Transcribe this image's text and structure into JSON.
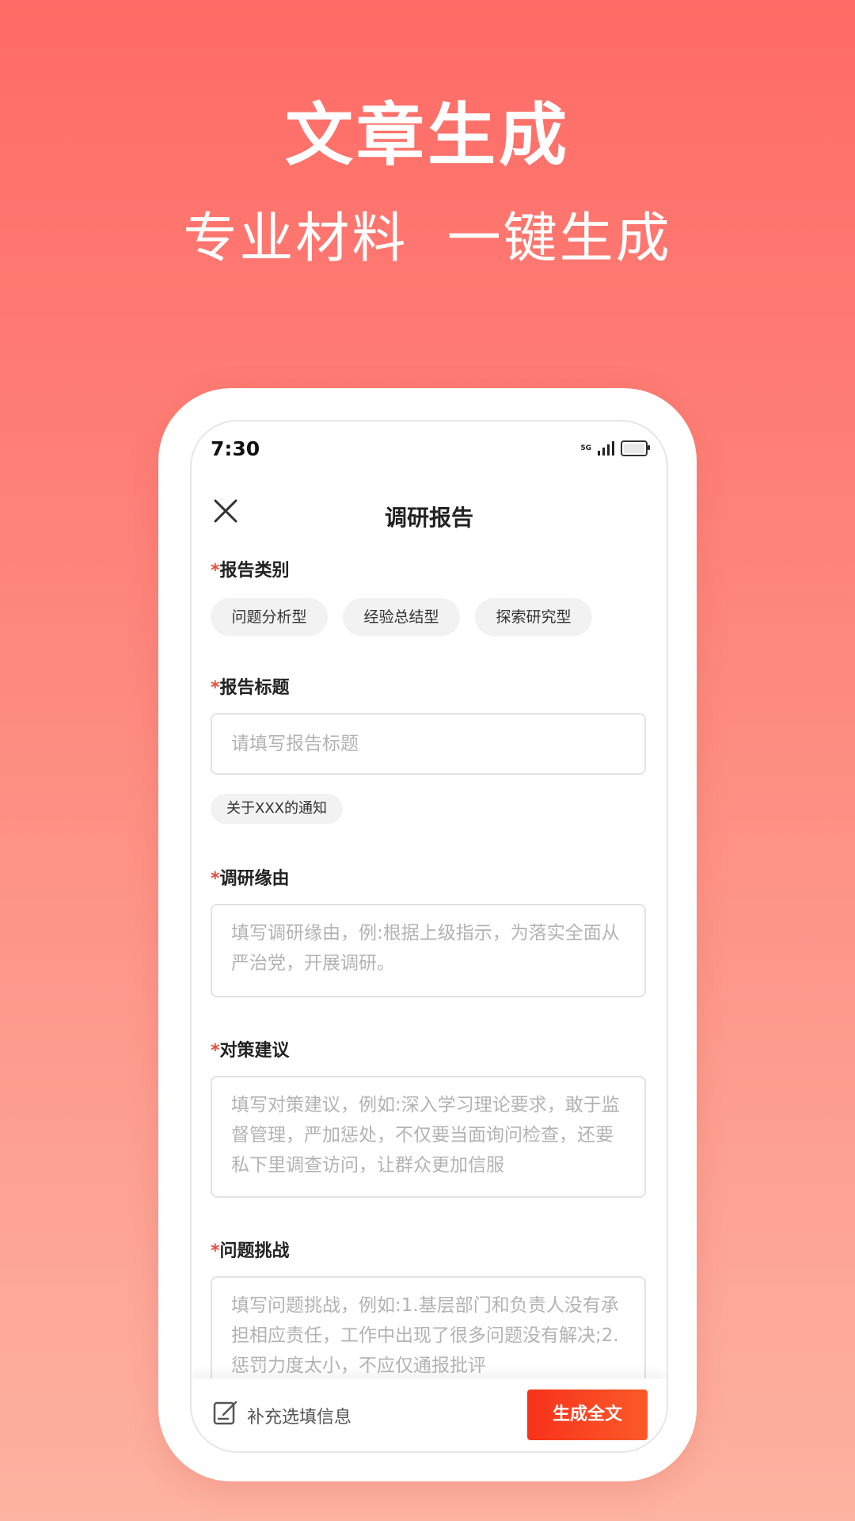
{
  "hero": {
    "title": "文章生成",
    "subtitle": "专业材料  一键生成"
  },
  "status_bar": {
    "time": "7:30",
    "network": "5G"
  },
  "nav": {
    "title": "调研报告"
  },
  "form": {
    "required_mark": "*",
    "report_category": {
      "label": "报告类别",
      "options": [
        "问题分析型",
        "经验总结型",
        "探索研究型"
      ]
    },
    "report_title": {
      "label": "报告标题",
      "placeholder": "请填写报告标题",
      "suggestion": "关于XXX的通知"
    },
    "research_reason": {
      "label": "调研缘由",
      "placeholder": "填写调研缘由，例:根据上级指示，为落实全面从严治党，开展调研。"
    },
    "countermeasures": {
      "label": "对策建议",
      "placeholder": "填写对策建议，例如:深入学习理论要求，敢于监督管理，严加惩处，不仅要当面询问检查，还要私下里调查访问，让群众更加信服"
    },
    "challenges": {
      "label": "问题挑战",
      "placeholder": "填写问题挑战，例如:1.基层部门和负责人没有承担相应责任，工作中出现了很多问题没有解决;2.惩罚力度太小，不应仅通报批评"
    }
  },
  "footer": {
    "supplement_label": "补充选填信息",
    "generate_label": "生成全文"
  }
}
